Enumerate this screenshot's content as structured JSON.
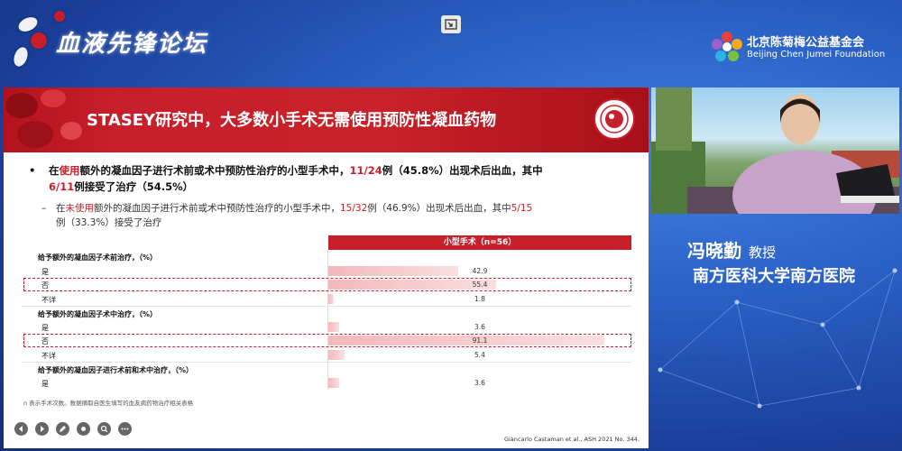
{
  "banner": {
    "forum_title": "血液先锋论坛",
    "foundation_cn": "北京陈菊梅公益基金会",
    "foundation_en": "Beijing Chen Jumei Foundation"
  },
  "slide": {
    "headline": "STASEY研究中，大多数小手术无需使用预防性凝血药物",
    "bullet1": {
      "p1": "在",
      "p2": "使用",
      "p3": "额外的凝血因子进行术前或术中预防性治疗的小型手术中，",
      "p4": "11/24",
      "p5": "例（45.8%）出现术后出血，其中",
      "p6": "6/11",
      "p7": "例接受了治疗（54.5%）"
    },
    "bullet2": {
      "p1": "在",
      "p2": "未使用",
      "p3": "额外的凝血因子进行术前或术中预防性治疗的小型手术中，",
      "p4": "15/32",
      "p5": "例（46.9%）出现术后出血，其中",
      "p6": "5/15",
      "p7": "例（33.3%）接受了治疗"
    },
    "table": {
      "column_header": "小型手术（n=56）",
      "rows": [
        {
          "label": "给予额外的凝血因子术前治疗，（%）",
          "type": "section"
        },
        {
          "label": "是",
          "value": "42.9",
          "pct": 42.9,
          "type": "item"
        },
        {
          "label": "否",
          "value": "55.4",
          "pct": 55.4,
          "type": "item",
          "highlight": true
        },
        {
          "label": "不详",
          "value": "1.8",
          "pct": 1.8,
          "type": "item"
        },
        {
          "label": "给予额外的凝血因子术中治疗，（%）",
          "type": "section"
        },
        {
          "label": "是",
          "value": "3.6",
          "pct": 3.6,
          "type": "item"
        },
        {
          "label": "否",
          "value": "91.1",
          "pct": 91.1,
          "type": "item",
          "highlight": true
        },
        {
          "label": "不详",
          "value": "5.4",
          "pct": 5.4,
          "type": "item"
        },
        {
          "label": "给予额外的凝血因子进行术前和术中治疗，（%）",
          "type": "section"
        },
        {
          "label": "是",
          "value": "3.6",
          "pct": 3.6,
          "type": "item"
        }
      ]
    },
    "footnote": "n 表示手术次数。数据摘取自医生填写的血友病药物治疗相关表格",
    "citation": "Giancarlo Castaman et al., ASH 2021 No. 344."
  },
  "presenter": {
    "name": "冯晓勤",
    "title": "教授",
    "hospital": "南方医科大学南方医院"
  },
  "colors": {
    "accent_red": "#c8202a",
    "background_blue": "#2a5fc4"
  }
}
